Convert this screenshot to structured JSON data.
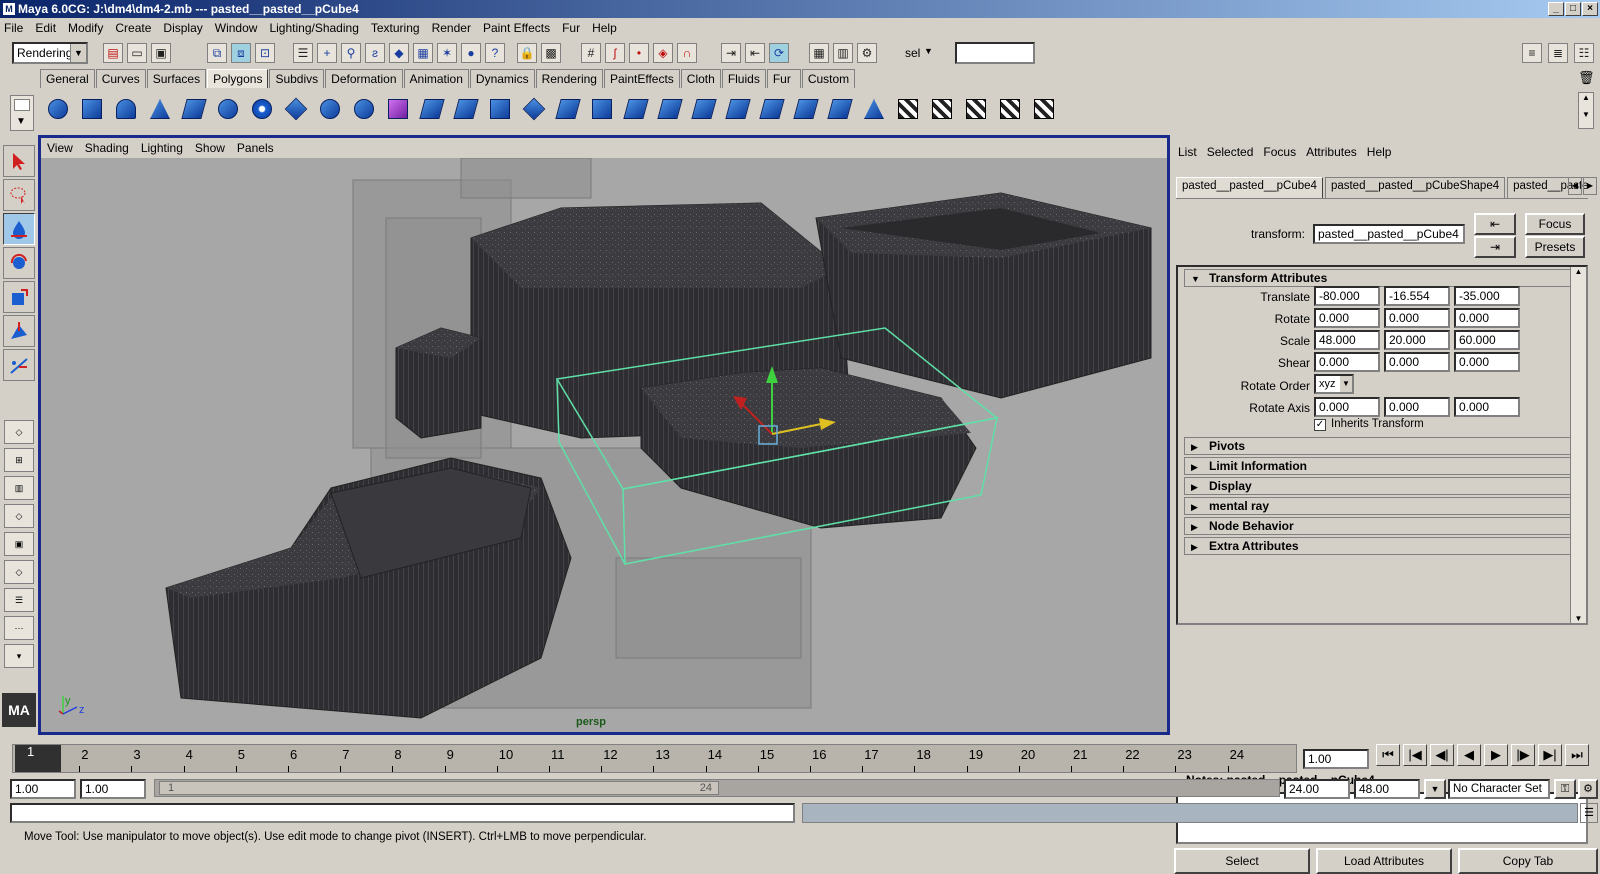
{
  "window": {
    "title": "Maya 6.0CG: J:\\dm4\\dm4-2.mb  ---  pasted__pasted__pCube4",
    "app_icon": "maya-icon"
  },
  "menubar": [
    "File",
    "Edit",
    "Modify",
    "Create",
    "Display",
    "Window",
    "Lighting/Shading",
    "Texturing",
    "Render",
    "Paint Effects",
    "Fur",
    "Help"
  ],
  "statusline": {
    "mode": "Rendering",
    "sel_label": "sel",
    "sel_value": ""
  },
  "shelf_tabs": [
    "General",
    "Curves",
    "Surfaces",
    "Polygons",
    "Subdivs",
    "Deformation",
    "Animation",
    "Dynamics",
    "Rendering",
    "PaintEffects",
    "Cloth",
    "Fluids",
    "Fur",
    "Custom"
  ],
  "shelf_active": "Polygons",
  "viewport": {
    "menu": [
      "View",
      "Shading",
      "Lighting",
      "Show",
      "Panels"
    ],
    "camera": "persp",
    "axis_labels": {
      "y": "y",
      "z": "z"
    }
  },
  "attribute_editor": {
    "menu": [
      "List",
      "Selected",
      "Focus",
      "Attributes",
      "Help"
    ],
    "tabs": [
      "pasted__pasted__pCube4",
      "pasted__pasted__pCubeShape4",
      "pasted__pasted"
    ],
    "transform_label": "transform:",
    "transform_value": "pasted__pasted__pCube4",
    "focus_label": "Focus",
    "presets_label": "Presets",
    "section_title": "Transform Attributes",
    "rows": [
      {
        "label": "Translate",
        "values": [
          "-80.000",
          "-16.554",
          "-35.000"
        ]
      },
      {
        "label": "Rotate",
        "values": [
          "0.000",
          "0.000",
          "0.000"
        ]
      },
      {
        "label": "Scale",
        "values": [
          "48.000",
          "20.000",
          "60.000"
        ]
      },
      {
        "label": "Shear",
        "values": [
          "0.000",
          "0.000",
          "0.000"
        ]
      }
    ],
    "rotate_order_label": "Rotate Order",
    "rotate_order_value": "xyz",
    "rotate_axis_label": "Rotate Axis",
    "rotate_axis_values": [
      "0.000",
      "0.000",
      "0.000"
    ],
    "inherits_label": "Inherits Transform",
    "inherits_checked": true,
    "collapsed_sections": [
      "Pivots",
      "Limit Information",
      "Display",
      "mental ray",
      "Node Behavior",
      "Extra Attributes"
    ],
    "notes_label": "Notes: pasted__pasted__pCube4",
    "buttons": {
      "select": "Select",
      "load": "Load Attributes",
      "copy": "Copy Tab"
    }
  },
  "timeline": {
    "ticks": [
      "1",
      "2",
      "3",
      "4",
      "5",
      "6",
      "7",
      "8",
      "9",
      "10",
      "11",
      "12",
      "13",
      "14",
      "15",
      "16",
      "17",
      "18",
      "19",
      "20",
      "21",
      "22",
      "23",
      "24"
    ],
    "current_frame": "1",
    "current_time_field": "1.00"
  },
  "range": {
    "start_field": "1.00",
    "start2_field": "1.00",
    "bar_start": "1",
    "bar_end": "24",
    "end_field": "24.00",
    "end2_field": "48.00",
    "character_set": "No Character Set"
  },
  "help_line": "Move Tool: Use manipulator to move object(s). Use edit mode to change pivot (INSERT).  Ctrl+LMB to move perpendicular.",
  "colors": {
    "viewport_bg": "#a7a7a7",
    "selection": "#5fe0a8",
    "title_bar": "#0a246a",
    "viewport_border": "#1a2a8a"
  }
}
